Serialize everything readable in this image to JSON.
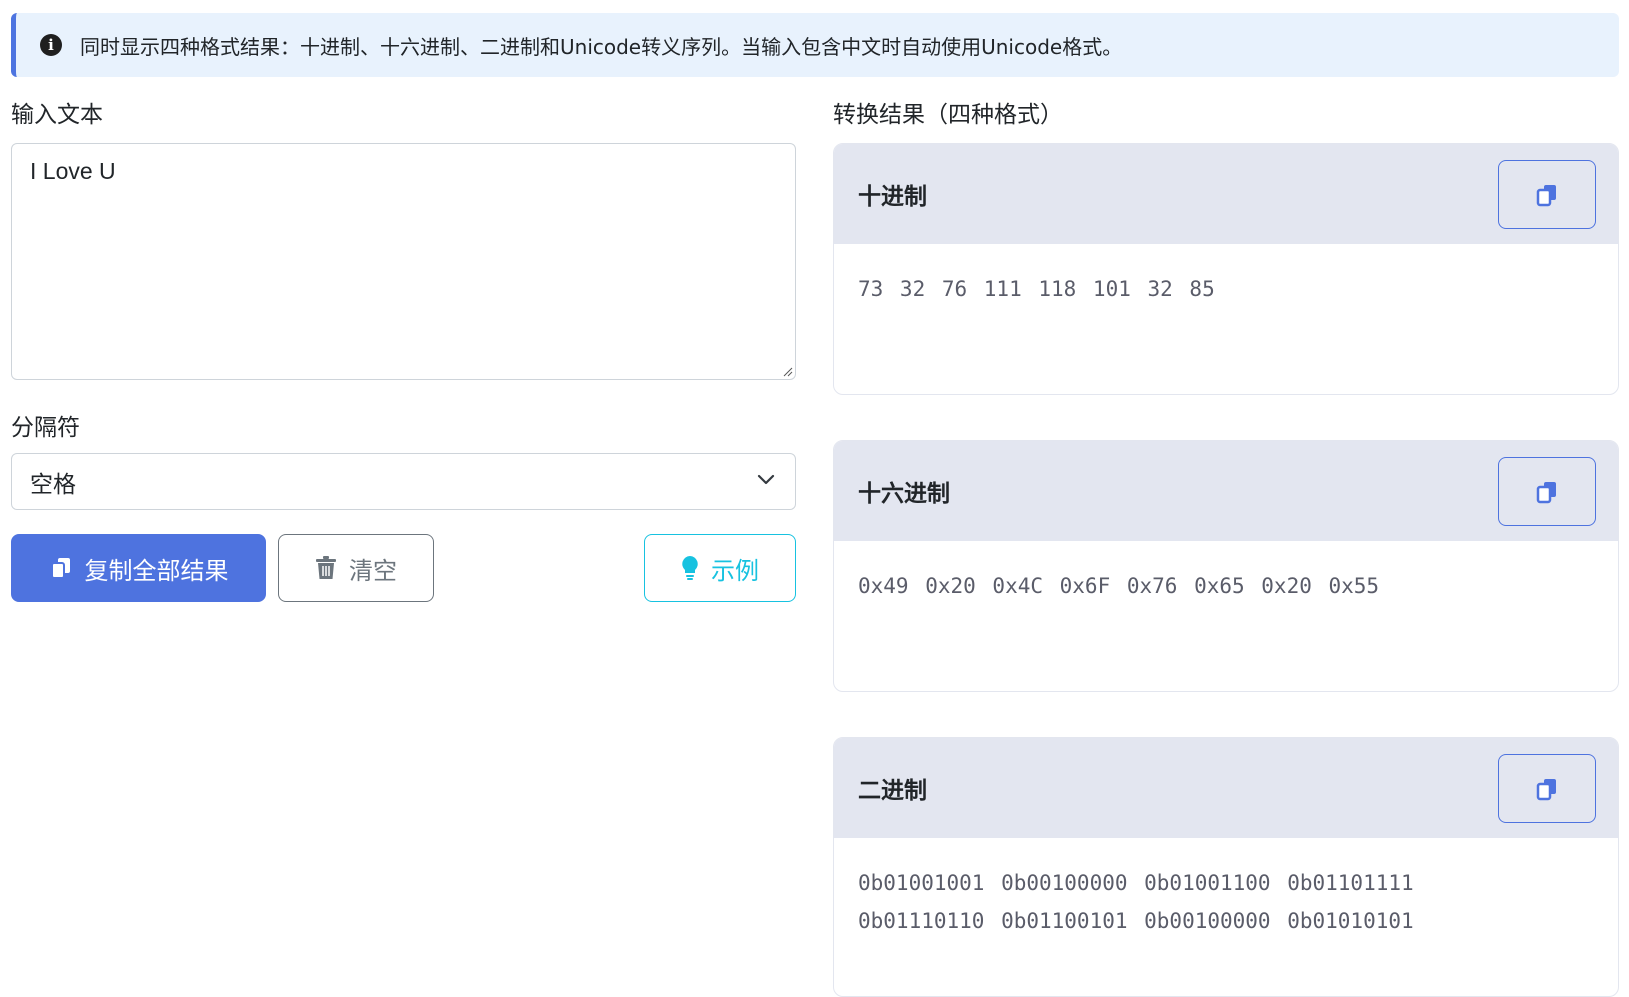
{
  "alert": {
    "icon": "info-icon",
    "text": "同时显示四种格式结果：十进制、十六进制、二进制和Unicode转义序列。当输入包含中文时自动使用Unicode格式。"
  },
  "input": {
    "label": "输入文本",
    "value": "I Love U"
  },
  "separator": {
    "label": "分隔符",
    "selected": "空格"
  },
  "buttons": {
    "copy_all": "复制全部结果",
    "clear": "清空",
    "example": "示例"
  },
  "results": {
    "label": "转换结果（四种格式）",
    "decimal": {
      "title": "十进制",
      "value": "73 32 76 111 118 101 32 85"
    },
    "hex": {
      "title": "十六进制",
      "value": "0x49 0x20 0x4C 0x6F 0x76 0x65 0x20 0x55"
    },
    "binary": {
      "title": "二进制",
      "value": "0b01001001 0b00100000 0b01001100 0b01101111\n0b01110110 0b01100101 0b00100000 0b01010101"
    }
  },
  "colors": {
    "primary": "#4e73df",
    "info": "#17c2e0",
    "secondary": "#6c757d",
    "alert_bg": "#e8f2fd"
  }
}
